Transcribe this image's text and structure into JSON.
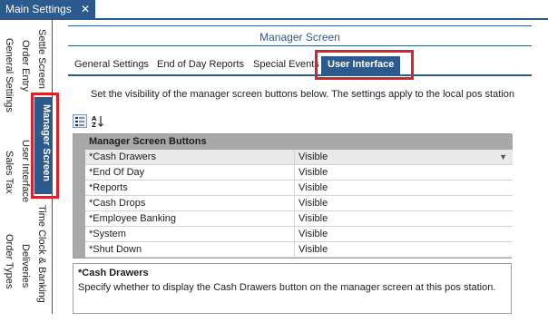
{
  "window": {
    "title": "Main Settings",
    "close_glyph": "✕"
  },
  "side_tabs": [
    {
      "label": "Settle Screen"
    },
    {
      "label": "Order Entry"
    },
    {
      "label": "General Settings"
    },
    {
      "label": "Manager Screen"
    },
    {
      "label": "User Interface"
    },
    {
      "label": "Sales Tax"
    },
    {
      "label": "Time Clock & Banking"
    },
    {
      "label": "Deliveries"
    },
    {
      "label": "Order Types"
    }
  ],
  "panel": {
    "title": "Manager Screen",
    "tabs": [
      {
        "label": "General Settings"
      },
      {
        "label": "End of Day Reports"
      },
      {
        "label": "Special Events"
      },
      {
        "label": "User Interface"
      }
    ],
    "description": "Set the visibility of the manager screen buttons below. The settings apply to the local pos station"
  },
  "grid": {
    "category": "Manager Screen Buttons",
    "rows": [
      {
        "name": "*Cash Drawers",
        "value": "Visible"
      },
      {
        "name": "*End Of Day",
        "value": "Visible"
      },
      {
        "name": "*Reports",
        "value": "Visible"
      },
      {
        "name": "*Cash Drops",
        "value": "Visible"
      },
      {
        "name": "*Employee Banking",
        "value": "Visible"
      },
      {
        "name": "*System",
        "value": "Visible"
      },
      {
        "name": "*Shut Down",
        "value": "Visible"
      }
    ]
  },
  "help": {
    "title": "*Cash Drawers",
    "text": "Specify whether to display the Cash Drawers button on the manager screen at this pos station."
  },
  "colors": {
    "accent": "#2d5a8c",
    "highlight": "#d9232a",
    "category_bg": "#a8a8a8"
  },
  "icons": [
    "close-icon",
    "categorized-view-icon",
    "sort-alphabetical-icon",
    "dropdown-arrow-icon"
  ]
}
